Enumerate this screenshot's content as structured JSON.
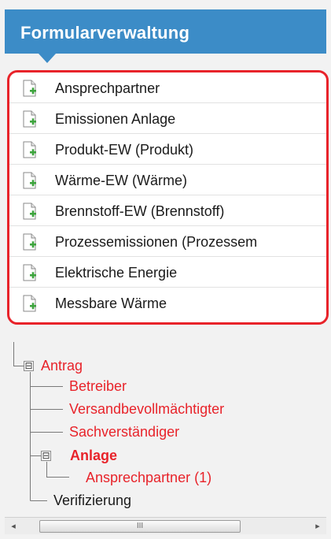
{
  "header": {
    "title": "Formularverwaltung"
  },
  "forms": {
    "items": [
      {
        "label": "Ansprechpartner",
        "icon": "document-add-icon"
      },
      {
        "label": "Emissionen Anlage",
        "icon": "document-add-icon"
      },
      {
        "label": "Produkt-EW (Produkt)",
        "icon": "document-add-icon"
      },
      {
        "label": "Wärme-EW (Wärme)",
        "icon": "document-add-icon"
      },
      {
        "label": "Brennstoff-EW (Brennstoff)",
        "icon": "document-add-icon"
      },
      {
        "label": "Prozessemissionen (Prozessem",
        "icon": "document-add-icon"
      },
      {
        "label": "Elektrische Energie",
        "icon": "document-add-icon"
      },
      {
        "label": "Messbare Wärme",
        "icon": "document-add-icon"
      }
    ]
  },
  "tree": {
    "root": {
      "label": "Antrag",
      "toggle": "⊟"
    },
    "betreiber": {
      "label": "Betreiber"
    },
    "versand": {
      "label": "Versandbevollmächtigter"
    },
    "sachverstaendiger": {
      "label": "Sachverständiger"
    },
    "anlage": {
      "label": "Anlage",
      "toggle": "⊟"
    },
    "ansprechpartner": {
      "label": "Ansprechpartner (1)"
    },
    "verifizierung": {
      "label": "Verifizierung"
    }
  },
  "scrollbar": {
    "left_arrow": "◂",
    "right_arrow": "▸",
    "grip": "III"
  },
  "colors": {
    "header": "#3c8cc7",
    "highlight_border": "#e8232a",
    "tree_red": "#e8232a"
  }
}
